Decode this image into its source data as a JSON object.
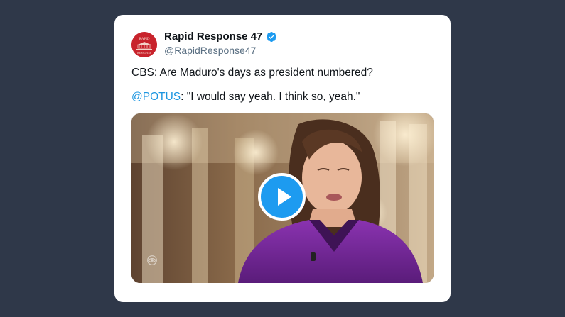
{
  "tweet": {
    "display_name": "Rapid Response 47",
    "handle": "@RapidResponse47",
    "verified": true,
    "avatar": {
      "icon": "rapid-response-logo-icon",
      "text": "RAPID RESPONSE"
    },
    "text_line1": "CBS: Are Maduro's days as president numbered?",
    "mention": "@POTUS",
    "quote": ": \"I would say yeah. I think so, yeah.\""
  },
  "media": {
    "type": "video",
    "play_icon": "play-icon",
    "watermark_icon": "cbs-eye-icon"
  },
  "colors": {
    "background": "#2f3849",
    "card": "#ffffff",
    "accent": "#1d9bf0",
    "mention": "#1b95e0",
    "avatar": "#c8232c",
    "jacket": "#7a2aa0"
  }
}
